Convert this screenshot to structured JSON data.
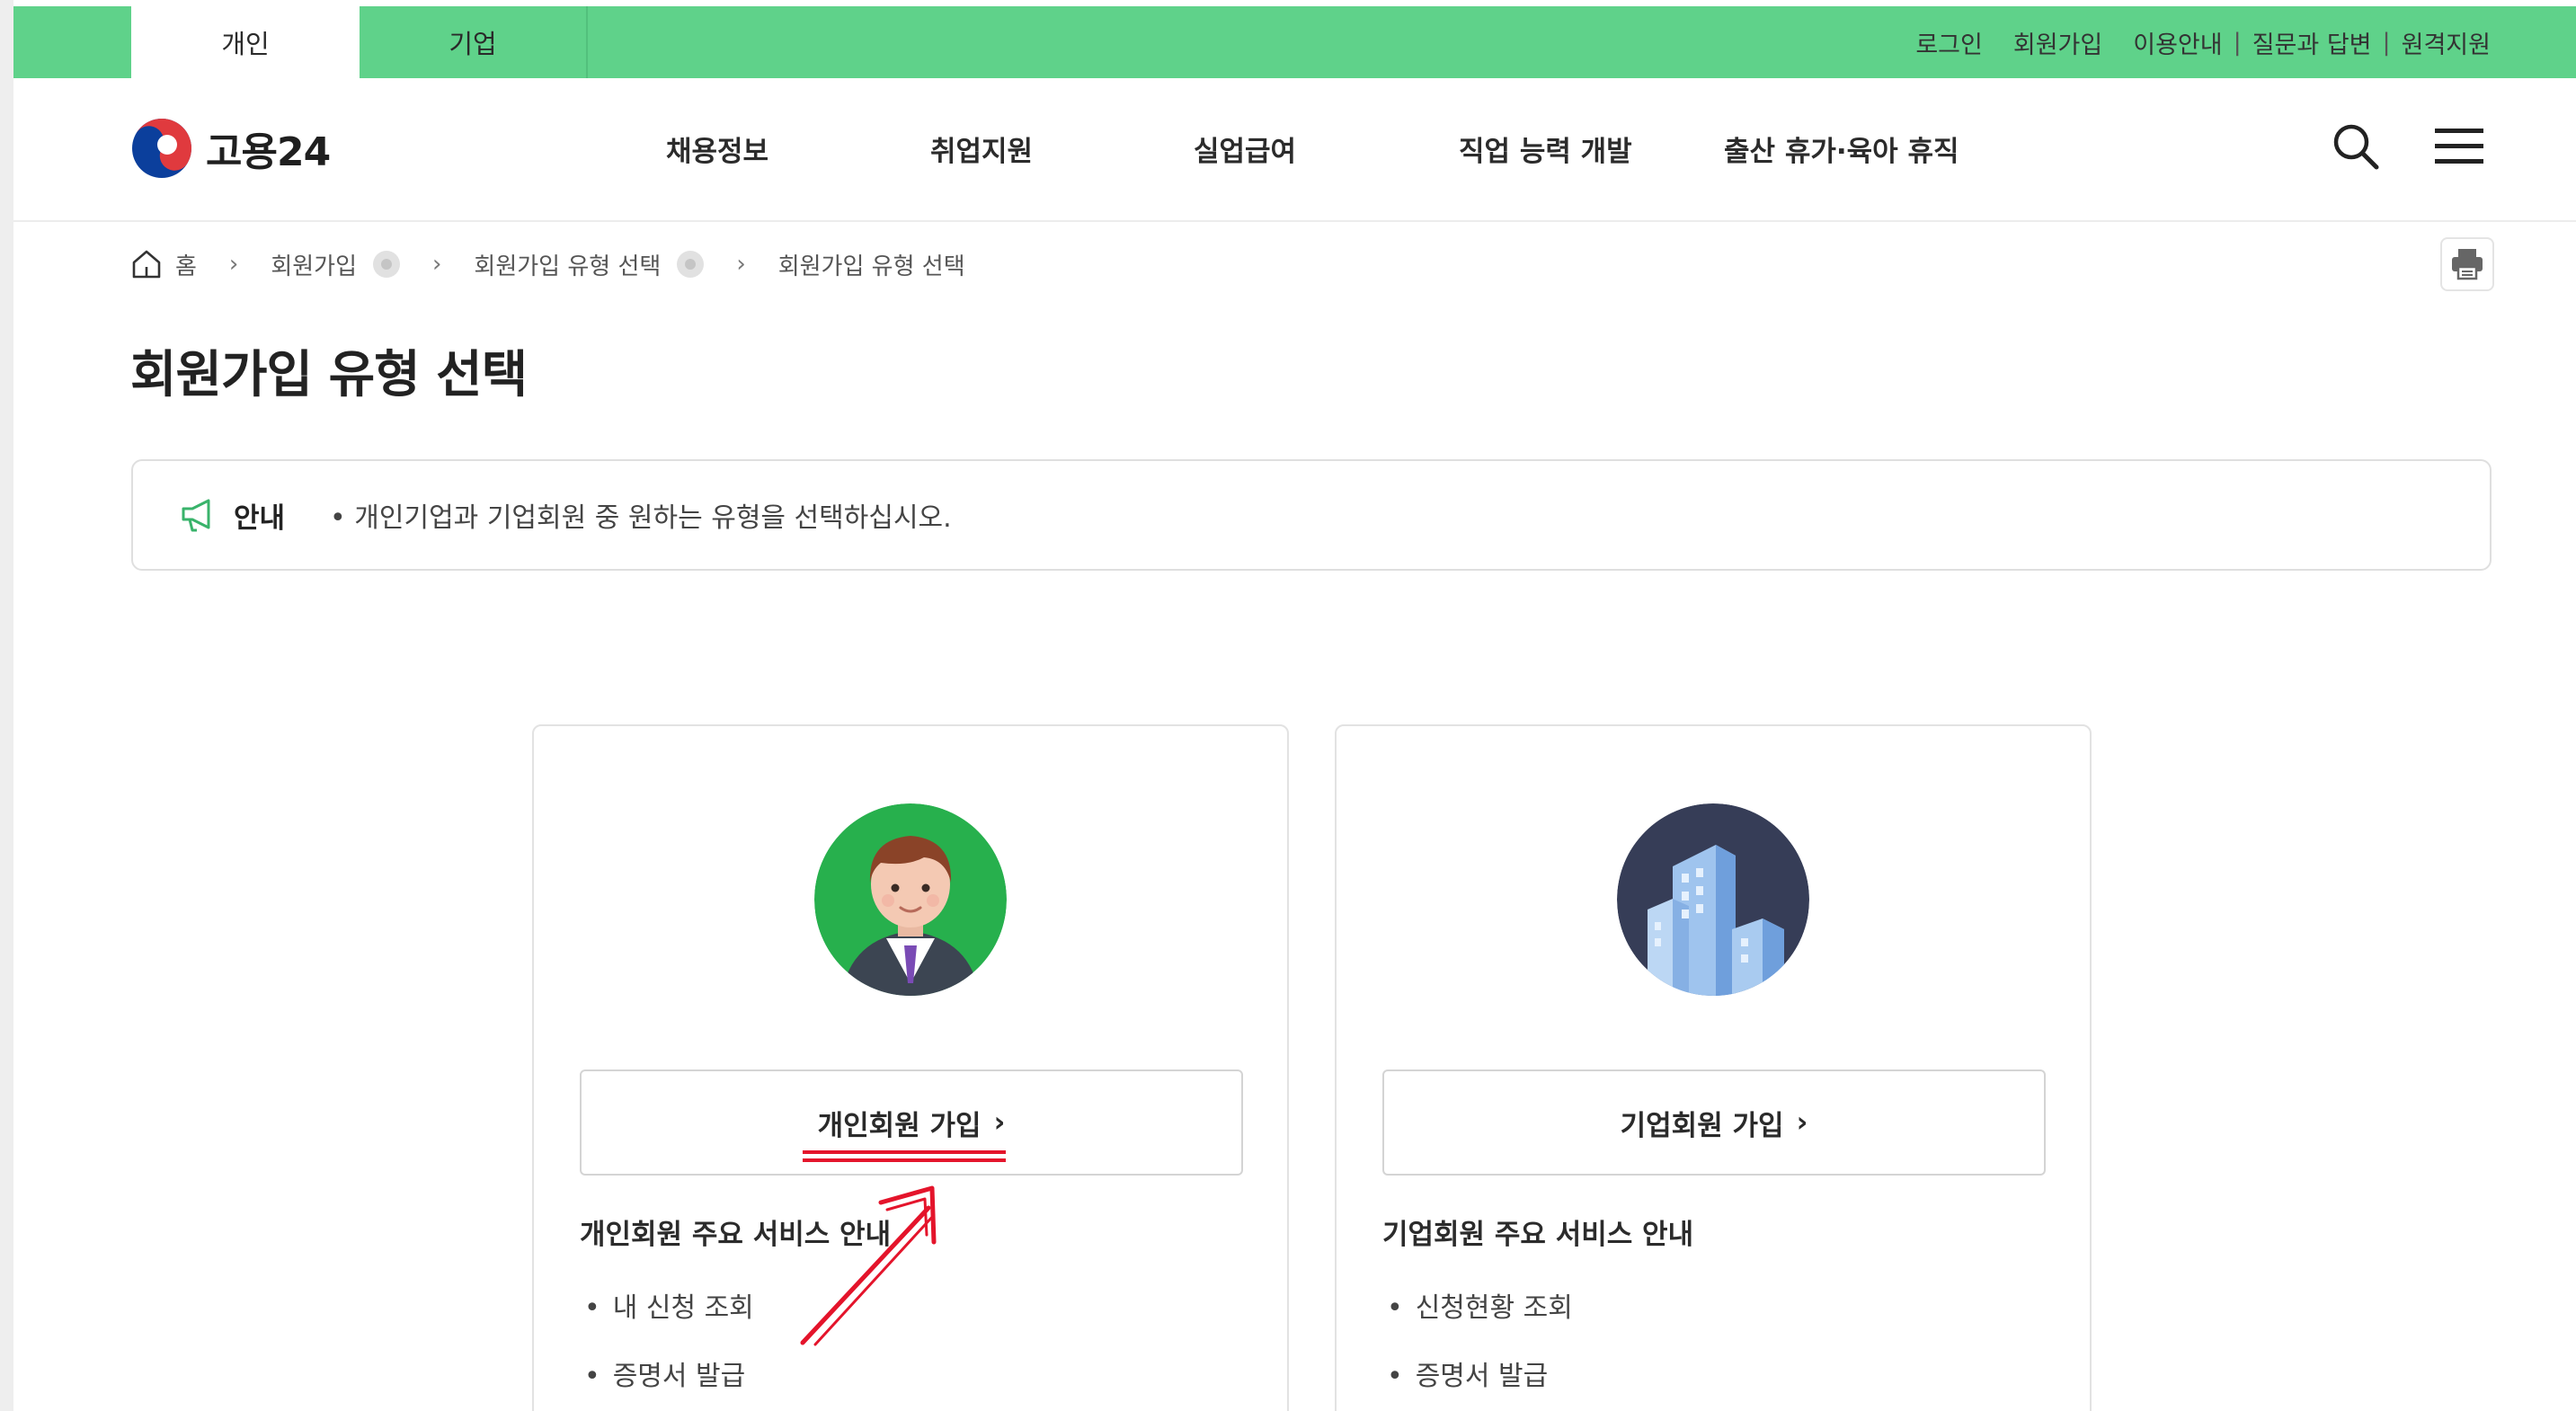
{
  "util_tabs": [
    "개인",
    "기업"
  ],
  "util_links": [
    "로그인",
    "회원가입",
    "이용안내",
    "질문과 답변",
    "원격지원"
  ],
  "logo": {
    "text": "고용24"
  },
  "gnb": [
    "채용정보",
    "취업지원",
    "실업급여",
    "직업 능력 개발",
    "출산 휴가·육아 휴직"
  ],
  "icons": {
    "search": "search-icon",
    "menu": "hamburger-menu-icon",
    "home": "home-icon",
    "print": "printer-icon",
    "notice": "megaphone-icon"
  },
  "breadcrumb": {
    "home": "홈",
    "level1": "회원가입",
    "level2": "회원가입 유형 선택",
    "current": "회원가입 유형 선택"
  },
  "page_title": "회원가입 유형 선택",
  "notice": {
    "label": "안내",
    "text": "• 개인기업과 기업회원 중 원하는 유형을 선택하십시오."
  },
  "cards": {
    "personal": {
      "button": "개인회원 가입",
      "services_title": "개인회원 주요 서비스 안내",
      "services": [
        "내 신청 조회",
        "증명서 발급"
      ]
    },
    "business": {
      "button": "기업회원 가입",
      "services_title": "기업회원 주요 서비스 안내",
      "services": [
        "신청현황 조회",
        "증명서 발급"
      ]
    }
  },
  "colors": {
    "util_bar": "#5fd28a",
    "annotation": "#e4142b",
    "avatar_bg": "#27b04d",
    "building_bg": "#363d57"
  }
}
